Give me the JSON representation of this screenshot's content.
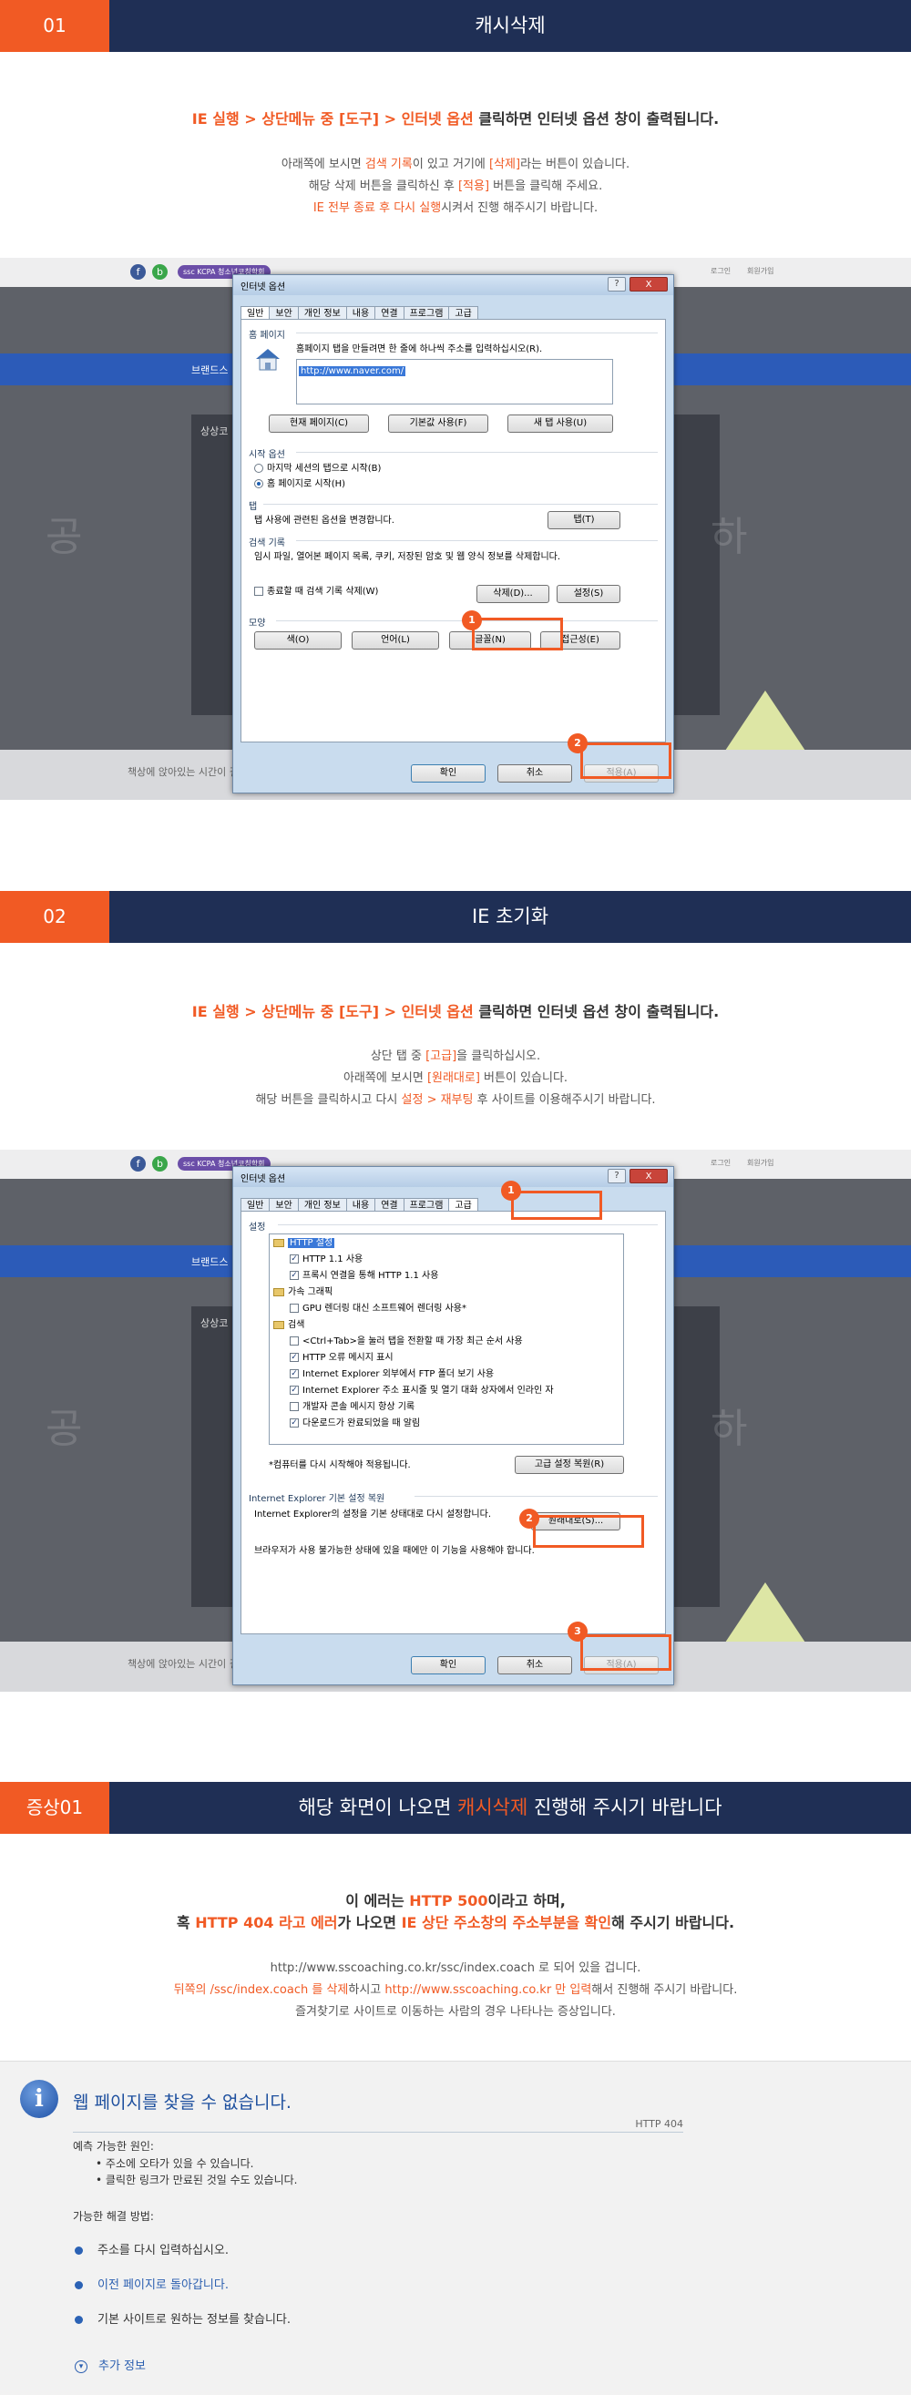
{
  "section1": {
    "num": "01",
    "title": "캐시삭제",
    "lead_a": "IE 실행 > 상단메뉴 중 [도구] > 인터넷 옵션",
    "lead_b": " 클릭하면 인터넷 옵션 창이 출력됩니다.",
    "line1_a": "아래쪽에 보시면 ",
    "line1_b": "검색 기록",
    "line1_c": "이 있고 거기에 ",
    "line1_d": "[삭제]",
    "line1_e": "라는 버튼이 있습니다.",
    "line2_a": "해당 삭제 버튼을 클릭하신 후 ",
    "line2_b": "[적용]",
    "line2_c": " 버튼을 클릭해 주세요.",
    "line3_a": "IE 전부 종료 후 다시 실행",
    "line3_b": "시켜서 진행 해주시기 바랍니다."
  },
  "section2": {
    "num": "02",
    "title": "IE 초기화",
    "lead_a": "IE 실행 > 상단메뉴 중 [도구] > 인터넷 옵션",
    "lead_b": " 클릭하면 인터넷 옵션 창이 출력됩니다.",
    "line1_a": "상단 탭 중 ",
    "line1_b": "[고급]",
    "line1_c": "을 클릭하십시오.",
    "line2_a": "아래쪽에 보시면 ",
    "line2_b": "[원래대로]",
    "line2_c": " 버튼이 있습니다.",
    "line3_a": "해당 버튼을 클릭하시고 다시 ",
    "line3_b": "설정 > 재부팅",
    "line3_c": " 후 사이트를 이용해주시기 바랍니다."
  },
  "section3": {
    "num": "증상01",
    "title_a": "해당 화면이 나오면 ",
    "title_b": "캐시삭제",
    "title_c": " 진행해 주시기 바랍니다",
    "lead1_a": "이 에러는 ",
    "lead1_b": "HTTP 500",
    "lead1_c": "이라고 하며,",
    "lead2_a": "혹 ",
    "lead2_b": "HTTP 404 라고 에러",
    "lead2_c": "가 나오면 ",
    "lead2_d": "IE 상단 주소창의 주소부분을 확인",
    "lead2_e": "해 주시기 바랍니다.",
    "line1": "http://www.sscoaching.co.kr/ssc/index.coach 로 되어 있을 겁니다.",
    "line2_a": "뒤쪽의 /ssc/index.coach 를 삭제",
    "line2_b": "하시고 ",
    "line2_c": "http://www.sscoaching.co.kr 만 입력",
    "line2_d": "해서 진행해 주시기 바랍니다.",
    "line3": "즐겨찾기로 사이트로 이동하는 사람의 경우 나타나는 증상입니다."
  },
  "site": {
    "badge": "ssc KCPA 청소년코칭학회",
    "login": "로그인",
    "join": "회원가입",
    "brand": "브랜드스",
    "side": "상상코",
    "caption": "책상에 앉아있는 시간이 길을 할 수록 우리 청소년들의 삶의 만족도는 최하위",
    "big_left": "공",
    "big_right": "하"
  },
  "dialog1": {
    "title": "인터넷 옵션",
    "help": "?",
    "close": "X",
    "tabs": [
      "일반",
      "보안",
      "개인 정보",
      "내용",
      "연결",
      "프로그램",
      "고급"
    ],
    "home_group": "홈 페이지",
    "home_desc": "홈페이지 탭을 만들려면 한 줄에 하나씩 주소를 입력하십시오(R).",
    "home_url": "http://www.naver.com/",
    "btn_current": "현재 페이지(C)",
    "btn_default": "기본값 사용(F)",
    "btn_newtab": "새 탭 사용(U)",
    "start_group": "시작 옵션",
    "radio1": "마지막 세션의 탭으로 시작(B)",
    "radio2": "홈 페이지로 시작(H)",
    "tab_group": "탭",
    "tab_desc": "탭 사용에 관련된 옵션을 변경합니다.",
    "btn_tabs": "탭(T)",
    "hist_group": "검색 기록",
    "hist_desc": "임시 파일, 열어본 페이지 목록, 쿠키, 저장된 암호 및 웹 양식 정보를 삭제합니다.",
    "hist_check": "종료할 때 검색 기록 삭제(W)",
    "btn_delete": "삭제(D)...",
    "btn_settings": "설정(S)",
    "look_group": "모양",
    "btn_color": "색(O)",
    "btn_lang": "언어(L)",
    "btn_font": "글꼴(N)",
    "btn_access": "접근성(E)",
    "btn_ok": "확인",
    "btn_cancel": "취소",
    "btn_apply": "적용(A)",
    "step1": "1",
    "step2": "2"
  },
  "dialog2": {
    "title": "인터넷 옵션",
    "help": "?",
    "close": "X",
    "tabs": [
      "일반",
      "보안",
      "개인 정보",
      "내용",
      "연결",
      "프로그램",
      "고급"
    ],
    "settings_group": "설정",
    "tree": [
      {
        "kind": "folder",
        "label": "HTTP 설정",
        "sel": true
      },
      {
        "kind": "check",
        "label": "HTTP 1.1 사용",
        "on": true
      },
      {
        "kind": "check",
        "label": "프록시 연결을 통해 HTTP 1.1 사용",
        "on": true
      },
      {
        "kind": "folder",
        "label": "가속 그래픽",
        "sel": false
      },
      {
        "kind": "check",
        "label": "GPU 렌더링 대신 소프트웨어 렌더링 사용*",
        "on": false
      },
      {
        "kind": "folder",
        "label": "검색",
        "sel": false
      },
      {
        "kind": "check",
        "label": "<Ctrl+Tab>을 눌러 탭을 전환할 때 가장 최근 순서 사용",
        "on": false
      },
      {
        "kind": "check",
        "label": "HTTP 오류 메시지 표시",
        "on": true
      },
      {
        "kind": "check",
        "label": "Internet Explorer 외부에서 FTP 폴더 보기 사용",
        "on": true
      },
      {
        "kind": "check",
        "label": "Internet Explorer 주소 표시줄 및 열기 대화 상자에서 인라인 자",
        "on": true
      },
      {
        "kind": "check",
        "label": "개발자 콘솔 메시지 항상 기록",
        "on": false
      },
      {
        "kind": "check",
        "label": "다운로드가 완료되었을 때 알림",
        "on": true
      }
    ],
    "restart_note": "*컴퓨터를 다시 시작해야 적용됩니다.",
    "btn_restore": "고급 설정 복원(R)",
    "reset_group": "Internet Explorer 기본 설정 복원",
    "reset_desc": "Internet Explorer의 설정을 기본 상태대로 다시 설정합니다.",
    "btn_reset": "원래대로(S)...",
    "reset_note": "브라우저가 사용 불가능한 상태에 있을 때에만 이 기능을 사용해야 합니다.",
    "btn_ok": "확인",
    "btn_cancel": "취소",
    "btn_apply": "적용(A)",
    "step1": "1",
    "step2": "2",
    "step3": "3"
  },
  "error_page": {
    "icon": "i",
    "title": "웹 페이지를 찾을 수 없습니다.",
    "code": "HTTP 404",
    "causes_title": "예측 가능한 원인:",
    "causes": [
      "주소에 오타가 있을 수 있습니다.",
      "클릭한 링크가 만료된 것일 수도 있습니다."
    ],
    "fixes_title": "가능한 해결 방법:",
    "fixes": [
      "주소를 다시 입력하십시오.",
      "이전 페이지로 돌아갑니다.",
      "기본 사이트로 원하는 정보를 찾습니다."
    ],
    "more": "추가 정보"
  }
}
